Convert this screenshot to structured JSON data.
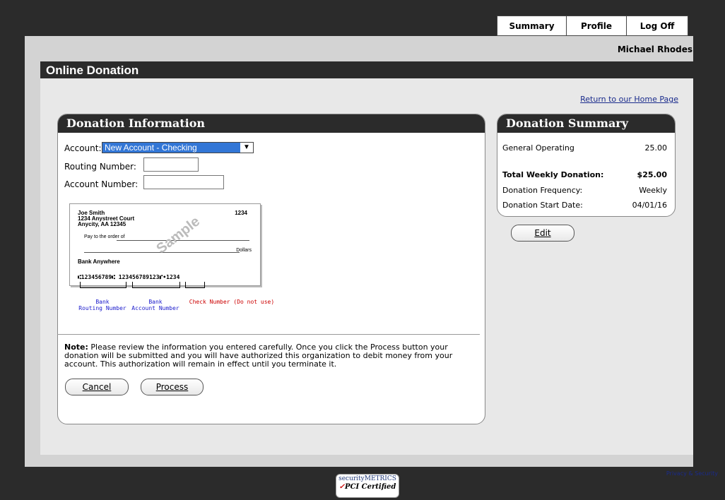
{
  "nav": {
    "tabs": [
      "Summary",
      "Profile",
      "Log Off"
    ]
  },
  "user": {
    "name": "Michael Rhodes"
  },
  "page": {
    "title": "Online Donation",
    "home_link": "Return to our Home Page"
  },
  "donation_info": {
    "heading": "Donation Information",
    "account_label": "Account:",
    "account_value": "New Account - Checking",
    "routing_label": "Routing Number:",
    "routing_value": "",
    "account_number_label": "Account Number:",
    "account_number_value": "",
    "check": {
      "name": "Joe Smith",
      "address1": "1234 Anystreet Court",
      "address2": "Anycity, AA 12345",
      "check_no": "1234",
      "pay_to": "Pay to the order of",
      "dollars": "Dollars",
      "bank": "Bank Anywhere",
      "micr": "⑆123456789⑆  123456789123⑈•1234",
      "watermark": "Sample"
    },
    "legend": {
      "routing": "Bank\nRouting Number",
      "account": "Bank\nAccount Number",
      "check_number": "Check Number (Do not use)"
    },
    "note_label": "Note:",
    "note_text": " Please review the information you entered carefully. Once you click the Process button your donation will be submitted and you will have authorized this organization to debit money from your account. This authorization will remain in effect until you terminate it.",
    "cancel": "Cancel",
    "process": "Process"
  },
  "summary": {
    "heading": "Donation Summary",
    "fund_label": "General Operating",
    "fund_value": "25.00",
    "total_label": "Total Weekly Donation:",
    "total_value": "$25.00",
    "freq_label": "Donation Frequency:",
    "freq_value": "Weekly",
    "start_label": "Donation Start Date:",
    "start_value": "04/01/16",
    "edit": "Edit"
  },
  "footer": {
    "badge_brand": "securityMETRICS",
    "badge_cert": "PCI Certified",
    "privacy": "Privacy & Security"
  },
  "colors": {
    "header": "#2b2b2b",
    "link": "#1a2b8c",
    "select": "#3276d6",
    "legend_blue": "#1a1acc",
    "legend_red": "#cc0000"
  }
}
